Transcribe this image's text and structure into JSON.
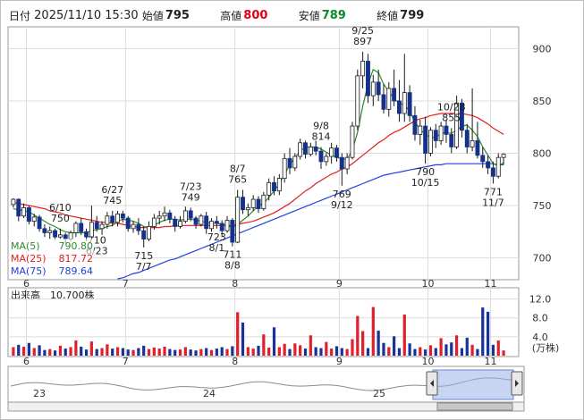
{
  "header": {
    "date_label": "日付",
    "datetime": "2025/11/10 15:30",
    "open_label": "始値",
    "open_value": "795",
    "high_label": "高値",
    "high_value": "800",
    "low_label": "安値",
    "low_value": "789",
    "close_label": "終値",
    "close_value": "799"
  },
  "legend": {
    "ma5_label": "MA(5)",
    "ma5_value": "790.80",
    "ma25_label": "MA(25)",
    "ma25_value": "817.72",
    "ma75_label": "MA(75)",
    "ma75_value": "789.64"
  },
  "volume": {
    "title": "出来高",
    "latest": "10,700株",
    "unit": "(万株)"
  },
  "navigator": {
    "labels": [
      "23",
      "24",
      "25"
    ]
  },
  "colors": {
    "up": "#ffffff",
    "down": "#14328a",
    "ma5": "#2f8a2f",
    "ma25": "#e02020",
    "ma75": "#2040e0",
    "vol_up": "#e0202a",
    "vol_down": "#18329a",
    "vol_other": "#888888"
  },
  "chart_data": {
    "type": "candlestick",
    "price_axis": {
      "ylim": [
        680,
        920
      ],
      "ticks": [
        "700",
        "750",
        "800",
        "850",
        "900"
      ]
    },
    "volume_axis": {
      "ylim": [
        0,
        14
      ],
      "ticks": [
        "4.0",
        "8.0",
        "12.0"
      ]
    },
    "month_ticks": [
      "6",
      "7",
      "8",
      "9",
      "10",
      "11"
    ],
    "annotations": [
      {
        "date": "6/10",
        "value": "750",
        "pos": "above"
      },
      {
        "date": "6/27",
        "value": "745",
        "pos": "above"
      },
      {
        "date": "7/23",
        "value": "749",
        "pos": "above"
      },
      {
        "date": "8/7",
        "value": "765",
        "pos": "above"
      },
      {
        "date": "9/8",
        "value": "814",
        "pos": "above"
      },
      {
        "date": "9/25",
        "value": "897",
        "pos": "above"
      },
      {
        "date": "10/28",
        "value": "855",
        "pos": "above"
      },
      {
        "date": "6/23",
        "value": "710",
        "pos": "below"
      },
      {
        "date": "7/7",
        "value": "715",
        "pos": "below"
      },
      {
        "date": "8/1",
        "value": "723",
        "pos": "below"
      },
      {
        "date": "8/8",
        "value": "711",
        "pos": "below"
      },
      {
        "date": "9/12",
        "value": "769",
        "pos": "below"
      },
      {
        "date": "10/15",
        "value": "790",
        "pos": "below"
      },
      {
        "date": "11/7",
        "value": "771",
        "pos": "below"
      }
    ],
    "candles": [
      [
        751,
        757,
        748,
        756
      ],
      [
        756,
        757,
        735,
        740
      ],
      [
        740,
        752,
        738,
        748
      ],
      [
        748,
        750,
        732,
        735
      ],
      [
        735,
        742,
        730,
        739
      ],
      [
        739,
        741,
        725,
        728
      ],
      [
        728,
        732,
        720,
        724
      ],
      [
        724,
        730,
        718,
        726
      ],
      [
        726,
        728,
        717,
        720
      ],
      [
        720,
        728,
        718,
        722
      ],
      [
        722,
        724,
        714,
        718
      ],
      [
        718,
        726,
        716,
        724
      ],
      [
        724,
        735,
        720,
        733
      ],
      [
        733,
        738,
        722,
        725
      ],
      [
        725,
        728,
        716,
        720
      ],
      [
        720,
        750,
        720,
        734
      ],
      [
        734,
        740,
        725,
        728
      ],
      [
        728,
        735,
        722,
        732
      ],
      [
        732,
        744,
        728,
        740
      ],
      [
        740,
        745,
        730,
        734
      ],
      [
        734,
        745,
        730,
        742
      ],
      [
        742,
        745,
        734,
        738
      ],
      [
        738,
        740,
        725,
        728
      ],
      [
        728,
        735,
        724,
        732
      ],
      [
        732,
        738,
        722,
        726
      ],
      [
        726,
        730,
        710,
        718
      ],
      [
        718,
        735,
        716,
        730
      ],
      [
        730,
        742,
        727,
        738
      ],
      [
        738,
        745,
        732,
        740
      ],
      [
        740,
        749,
        735,
        743
      ],
      [
        743,
        746,
        733,
        737
      ],
      [
        737,
        740,
        725,
        730
      ],
      [
        730,
        740,
        728,
        735
      ],
      [
        735,
        749,
        733,
        745
      ],
      [
        745,
        748,
        735,
        738
      ],
      [
        738,
        740,
        728,
        732
      ],
      [
        732,
        742,
        730,
        740
      ],
      [
        740,
        744,
        723,
        728
      ],
      [
        728,
        738,
        725,
        735
      ],
      [
        735,
        740,
        728,
        733
      ],
      [
        733,
        736,
        720,
        726
      ],
      [
        726,
        740,
        724,
        736
      ],
      [
        736,
        738,
        711,
        715
      ],
      [
        715,
        765,
        714,
        758
      ],
      [
        758,
        765,
        742,
        746
      ],
      [
        746,
        752,
        740,
        748
      ],
      [
        748,
        760,
        745,
        756
      ],
      [
        756,
        759,
        743,
        747
      ],
      [
        747,
        763,
        745,
        760
      ],
      [
        760,
        776,
        755,
        772
      ],
      [
        772,
        778,
        760,
        764
      ],
      [
        764,
        780,
        760,
        776
      ],
      [
        776,
        800,
        772,
        795
      ],
      [
        795,
        805,
        780,
        786
      ],
      [
        786,
        800,
        783,
        797
      ],
      [
        797,
        814,
        794,
        810
      ],
      [
        810,
        812,
        795,
        799
      ],
      [
        799,
        810,
        797,
        806
      ],
      [
        806,
        812,
        798,
        802
      ],
      [
        802,
        806,
        785,
        792
      ],
      [
        792,
        800,
        788,
        797
      ],
      [
        797,
        810,
        790,
        805
      ],
      [
        805,
        808,
        792,
        796
      ],
      [
        796,
        800,
        769,
        785
      ],
      [
        785,
        800,
        780,
        796
      ],
      [
        796,
        830,
        794,
        826
      ],
      [
        826,
        880,
        822,
        874
      ],
      [
        874,
        897,
        862,
        888
      ],
      [
        888,
        895,
        848,
        855
      ],
      [
        855,
        875,
        845,
        868
      ],
      [
        868,
        880,
        850,
        856
      ],
      [
        856,
        866,
        838,
        842
      ],
      [
        842,
        868,
        835,
        862
      ],
      [
        862,
        880,
        845,
        850
      ],
      [
        850,
        870,
        830,
        838
      ],
      [
        838,
        895,
        830,
        858
      ],
      [
        858,
        865,
        830,
        836
      ],
      [
        836,
        845,
        812,
        818
      ],
      [
        818,
        832,
        808,
        826
      ],
      [
        826,
        835,
        790,
        800
      ],
      [
        800,
        825,
        797,
        822
      ],
      [
        822,
        828,
        805,
        812
      ],
      [
        812,
        830,
        808,
        826
      ],
      [
        826,
        832,
        810,
        818
      ],
      [
        818,
        824,
        800,
        806
      ],
      [
        806,
        855,
        804,
        848
      ],
      [
        848,
        852,
        815,
        822
      ],
      [
        822,
        828,
        800,
        806
      ],
      [
        806,
        862,
        802,
        812
      ],
      [
        812,
        830,
        795,
        798
      ],
      [
        798,
        806,
        786,
        792
      ],
      [
        792,
        798,
        780,
        786
      ],
      [
        786,
        792,
        771,
        778
      ],
      [
        778,
        800,
        776,
        796
      ],
      [
        796,
        800,
        789,
        799
      ]
    ],
    "volumes": [
      1.8,
      2.3,
      1.9,
      2.7,
      1.6,
      2.2,
      1.2,
      1.4,
      1.1,
      2.1,
      1.5,
      1.8,
      3.2,
      1.9,
      1.3,
      3.0,
      1.4,
      1.6,
      2.4,
      1.5,
      1.8,
      1.6,
      1.3,
      1.2,
      1.6,
      2.1,
      1.4,
      1.7,
      1.5,
      1.9,
      1.4,
      1.2,
      1.3,
      1.8,
      1.3,
      1.1,
      1.4,
      1.6,
      1.2,
      1.5,
      1.8,
      1.4,
      2.0,
      9.2,
      7.0,
      1.8,
      1.5,
      2.1,
      4.5,
      1.7,
      6.0,
      1.8,
      2.5,
      1.4,
      2.6,
      2.2,
      1.5,
      4.3,
      1.8,
      1.6,
      2.9,
      1.5,
      2.0,
      1.6,
      1.4,
      3.5,
      8.4,
      5.2,
      1.6,
      10.3,
      5.3,
      2.7,
      1.8,
      4.1,
      1.6,
      8.7,
      2.6,
      1.4,
      1.8,
      1.3,
      2.2,
      1.6,
      3.7,
      2.4,
      2.8,
      4.3,
      1.6,
      3.8,
      2.3,
      1.4,
      10.2,
      9.3,
      2.3,
      3.2,
      1.1
    ],
    "ma5": [
      747,
      746,
      745,
      744,
      741,
      738,
      735,
      732,
      730,
      727,
      725,
      724,
      724,
      724,
      724,
      726,
      727,
      728,
      730,
      731,
      735,
      737,
      736,
      735,
      733,
      730,
      729,
      731,
      734,
      736,
      737,
      737,
      736,
      737,
      737,
      736,
      735,
      734,
      733,
      733,
      732,
      731,
      729,
      732,
      736,
      740,
      745,
      750,
      752,
      758,
      764,
      771,
      780,
      789,
      796,
      802,
      806,
      806,
      806,
      804,
      801,
      798,
      796,
      795,
      794,
      803,
      820,
      845,
      866,
      880,
      877,
      866,
      859,
      852,
      848,
      846,
      840,
      830,
      823,
      818,
      815,
      815,
      819,
      820,
      819,
      822,
      826,
      827,
      822,
      816,
      806,
      798,
      790,
      788,
      791
    ],
    "ma25": [
      753,
      752,
      751,
      750,
      749,
      748,
      747,
      745,
      744,
      743,
      741,
      740,
      739,
      738,
      737,
      736,
      735,
      734,
      734,
      733,
      733,
      732,
      731,
      730,
      729,
      729,
      729,
      729,
      729,
      730,
      730,
      731,
      731,
      731,
      731,
      731,
      731,
      731,
      731,
      731,
      731,
      731,
      731,
      732,
      733,
      734,
      735,
      737,
      739,
      741,
      743,
      746,
      749,
      752,
      756,
      760,
      764,
      767,
      771,
      774,
      777,
      780,
      782,
      785,
      787,
      790,
      794,
      798,
      802,
      806,
      810,
      813,
      817,
      820,
      822,
      825,
      828,
      831,
      833,
      834,
      836,
      837,
      838,
      838,
      838,
      838,
      838,
      837,
      836,
      834,
      831,
      828,
      824,
      821,
      818
    ],
    "ma75": [
      null,
      null,
      null,
      null,
      null,
      null,
      null,
      null,
      null,
      null,
      null,
      null,
      null,
      null,
      null,
      null,
      null,
      null,
      null,
      null,
      680,
      681,
      683,
      685,
      686,
      688,
      690,
      692,
      694,
      696,
      698,
      699,
      701,
      703,
      705,
      707,
      709,
      711,
      713,
      715,
      717,
      719,
      721,
      723,
      725,
      727,
      729,
      731,
      733,
      735,
      737,
      739,
      741,
      743,
      745,
      747,
      749,
      751,
      753,
      755,
      757,
      759,
      761,
      763,
      765,
      767,
      769,
      771,
      773,
      775,
      777,
      779,
      780,
      781,
      782,
      783,
      784,
      785,
      786,
      787,
      788,
      789,
      789,
      790,
      790,
      790,
      790,
      790,
      790,
      790,
      790,
      790,
      790,
      789,
      789
    ]
  }
}
